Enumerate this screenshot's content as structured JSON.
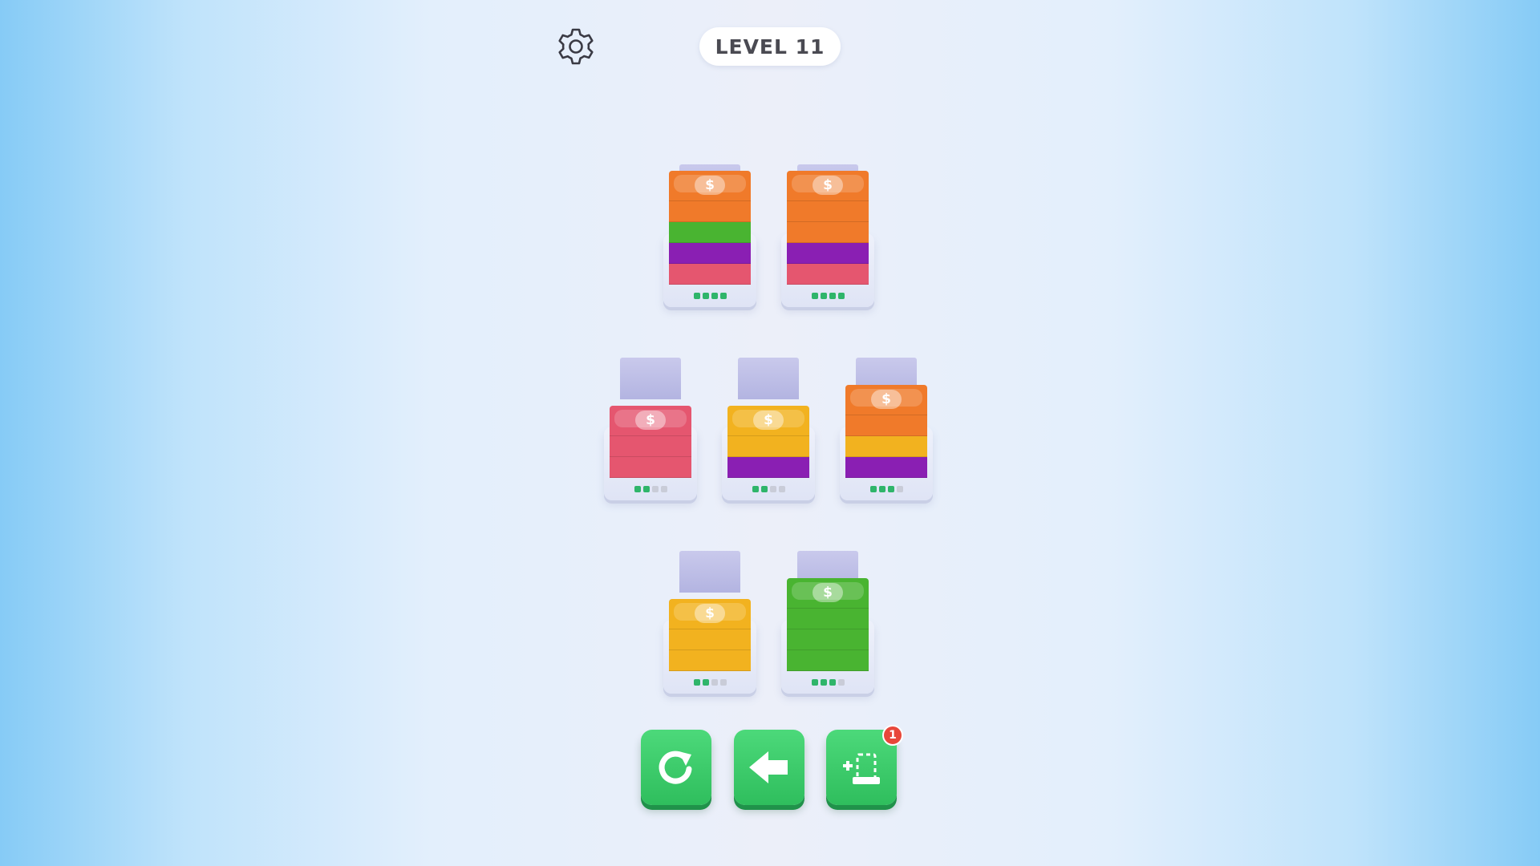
{
  "header": {
    "level_label": "LEVEL 11",
    "settings_icon": "gear-icon"
  },
  "colors": {
    "orange": "#f07a2a",
    "green": "#49b431",
    "purple": "#8a1fb3",
    "pink": "#e5566f",
    "yellow": "#f2b21f"
  },
  "currency_symbol": "$",
  "stacks": [
    {
      "id": "stack-1",
      "layers": [
        "pink",
        "purple",
        "green",
        "orange",
        "orange"
      ],
      "filled": 4,
      "capacity": 4
    },
    {
      "id": "stack-2",
      "layers": [
        "pink",
        "purple",
        "orange",
        "orange",
        "orange"
      ],
      "filled": 4,
      "capacity": 4
    },
    {
      "id": "stack-3",
      "layers": [
        "pink",
        "pink",
        "pink"
      ],
      "filled": 2,
      "capacity": 4
    },
    {
      "id": "stack-4",
      "layers": [
        "purple",
        "yellow",
        "yellow"
      ],
      "filled": 2,
      "capacity": 4
    },
    {
      "id": "stack-5",
      "layers": [
        "purple",
        "yellow",
        "orange",
        "orange"
      ],
      "filled": 3,
      "capacity": 4
    },
    {
      "id": "stack-6",
      "layers": [
        "yellow",
        "yellow",
        "yellow"
      ],
      "filled": 2,
      "capacity": 4
    },
    {
      "id": "stack-7",
      "layers": [
        "green",
        "green",
        "green",
        "green"
      ],
      "filled": 3,
      "capacity": 4
    }
  ],
  "toolbar": {
    "restart_icon": "restart-icon",
    "undo_icon": "undo-arrow-icon",
    "add_slot_icon": "add-slot-icon",
    "add_slot_badge": "1"
  }
}
